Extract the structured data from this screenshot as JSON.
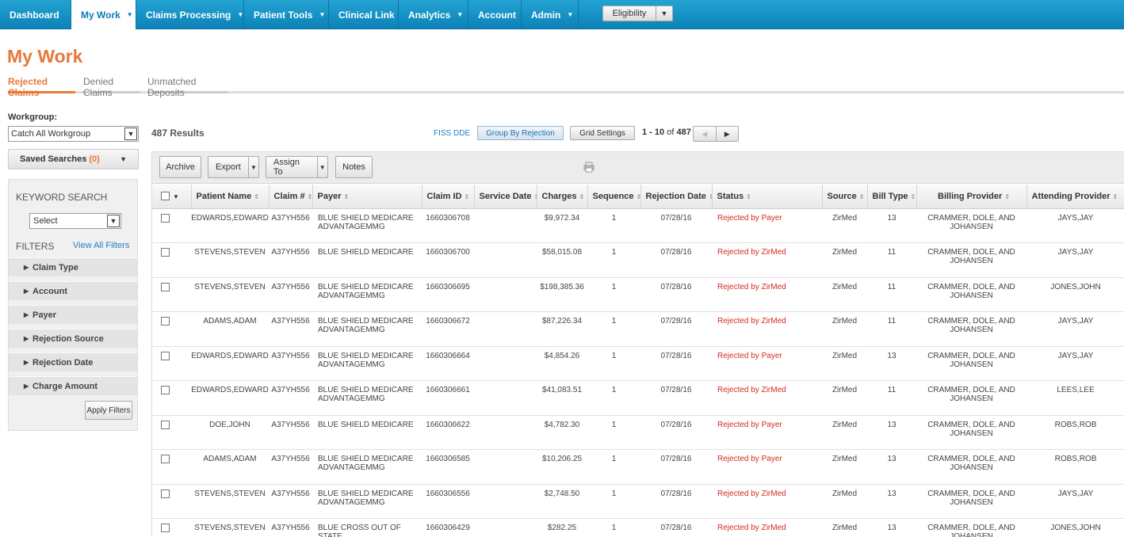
{
  "nav": {
    "items": [
      {
        "label": "Dashboard",
        "caret": false
      },
      {
        "label": "My Work",
        "caret": true
      },
      {
        "label": "Claims Processing",
        "caret": true
      },
      {
        "label": "Patient Tools",
        "caret": true
      },
      {
        "label": "Clinical Link",
        "caret": false
      },
      {
        "label": "Analytics",
        "caret": true
      },
      {
        "label": "Account",
        "caret": false
      },
      {
        "label": "Admin",
        "caret": true
      }
    ],
    "eligibility_label": "Eligibility"
  },
  "page_title": "My Work",
  "tabs": [
    "Rejected Claims",
    "Denied Claims",
    "Unmatched Deposits"
  ],
  "sidebar": {
    "workgroup_label": "Workgroup:",
    "workgroup_value": "Catch All Workgroup",
    "saved_searches_label": "Saved Searches",
    "saved_searches_count": "(0)",
    "keyword_search_label": "KEYWORD SEARCH",
    "keyword_select_value": "Select",
    "filters_label": "FILTERS",
    "view_all_filters": "View All Filters",
    "filters": [
      "Claim Type",
      "Account",
      "Payer",
      "Rejection Source",
      "Rejection Date",
      "Charge Amount"
    ],
    "apply_filters": "Apply Filters"
  },
  "results": {
    "count_text": "487 Results",
    "fiss_dde": "FISS DDE",
    "group_by": "Group By Rejection",
    "grid_settings": "Grid Settings",
    "range": "1 - 10",
    "of_label": "of",
    "total": "487"
  },
  "toolbar": {
    "archive": "Archive",
    "export": "Export",
    "assign_to": "Assign To",
    "notes": "Notes"
  },
  "table": {
    "columns": [
      "Patient Name",
      "Claim #",
      "Payer",
      "Claim ID",
      "Service Date",
      "Charges",
      "Sequence",
      "Rejection Date",
      "Status",
      "Source",
      "Bill Type",
      "Billing Provider",
      "Attending Provider"
    ],
    "rows": [
      [
        "EDWARDS,EDWARD",
        "A37YH556",
        "BLUE SHIELD MEDICARE ADVANTAGEMMG",
        "1660306708",
        "",
        "$9,972.34",
        "1",
        "07/28/16",
        "Rejected by Payer",
        "ZirMed",
        "13",
        "CRAMMER, DOLE, AND JOHANSEN",
        "JAYS,JAY"
      ],
      [
        "STEVENS,STEVEN",
        "A37YH556",
        "BLUE SHIELD MEDICARE",
        "1660306700",
        "",
        "$58,015.08",
        "1",
        "07/28/16",
        "Rejected by ZirMed",
        "ZirMed",
        "11",
        "CRAMMER, DOLE, AND JOHANSEN",
        "JAYS,JAY"
      ],
      [
        "STEVENS,STEVEN",
        "A37YH556",
        "BLUE SHIELD MEDICARE ADVANTAGEMMG",
        "1660306695",
        "",
        "$198,385.36",
        "1",
        "07/28/16",
        "Rejected by ZirMed",
        "ZirMed",
        "11",
        "CRAMMER, DOLE, AND JOHANSEN",
        "JONES,JOHN"
      ],
      [
        "ADAMS,ADAM",
        "A37YH556",
        "BLUE SHIELD MEDICARE ADVANTAGEMMG",
        "1660306672",
        "",
        "$87,226.34",
        "1",
        "07/28/16",
        "Rejected by ZirMed",
        "ZirMed",
        "11",
        "CRAMMER, DOLE, AND JOHANSEN",
        "JAYS,JAY"
      ],
      [
        "EDWARDS,EDWARD",
        "A37YH556",
        "BLUE SHIELD MEDICARE ADVANTAGEMMG",
        "1660306664",
        "",
        "$4,854.26",
        "1",
        "07/28/16",
        "Rejected by Payer",
        "ZirMed",
        "13",
        "CRAMMER, DOLE, AND JOHANSEN",
        "JAYS,JAY"
      ],
      [
        "EDWARDS,EDWARD",
        "A37YH556",
        "BLUE SHIELD MEDICARE ADVANTAGEMMG",
        "1660306661",
        "",
        "$41,083.51",
        "1",
        "07/28/16",
        "Rejected by ZirMed",
        "ZirMed",
        "11",
        "CRAMMER, DOLE, AND JOHANSEN",
        "LEES,LEE"
      ],
      [
        "DOE,JOHN",
        "A37YH556",
        "BLUE SHIELD MEDICARE",
        "1660306622",
        "",
        "$4,782.30",
        "1",
        "07/28/16",
        "Rejected by Payer",
        "ZirMed",
        "13",
        "CRAMMER, DOLE, AND JOHANSEN",
        "ROBS,ROB"
      ],
      [
        "ADAMS,ADAM",
        "A37YH556",
        "BLUE SHIELD MEDICARE ADVANTAGEMMG",
        "1660306585",
        "",
        "$10,206.25",
        "1",
        "07/28/16",
        "Rejected by Payer",
        "ZirMed",
        "13",
        "CRAMMER, DOLE, AND JOHANSEN",
        "ROBS,ROB"
      ],
      [
        "STEVENS,STEVEN",
        "A37YH556",
        "BLUE SHIELD MEDICARE ADVANTAGEMMG",
        "1660306556",
        "",
        "$2,748.50",
        "1",
        "07/28/16",
        "Rejected by ZirMed",
        "ZirMed",
        "13",
        "CRAMMER, DOLE, AND JOHANSEN",
        "JAYS,JAY"
      ],
      [
        "STEVENS,STEVEN",
        "A37YH556",
        "BLUE CROSS OUT OF STATE",
        "1660306429",
        "",
        "$282.25",
        "1",
        "07/28/16",
        "Rejected by ZirMed",
        "ZirMed",
        "13",
        "CRAMMER, DOLE, AND JOHANSEN",
        "JONES,JOHN"
      ]
    ]
  },
  "colors": {
    "nav_blue": "#1597c9",
    "accent_orange": "#e8793a",
    "link_blue": "#1d82c4",
    "status_red": "#d42a20"
  }
}
